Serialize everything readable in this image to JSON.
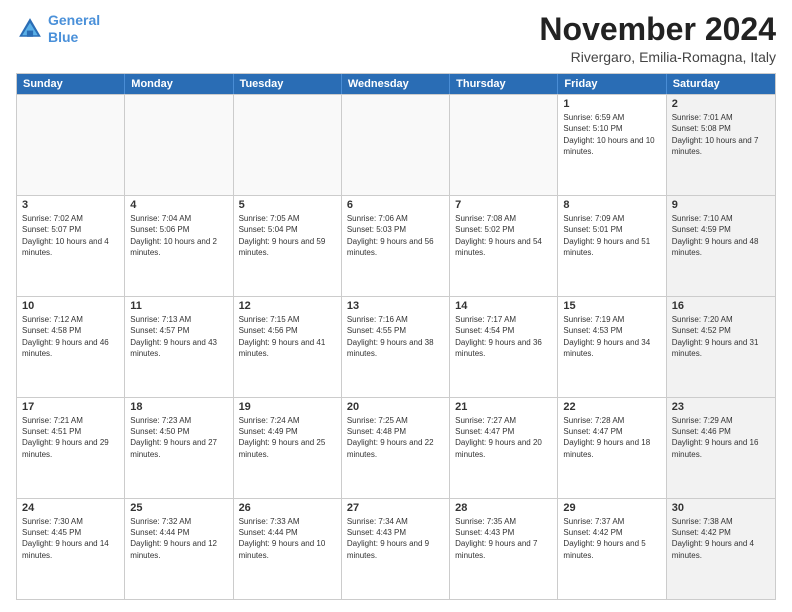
{
  "logo": {
    "line1": "General",
    "line2": "Blue"
  },
  "title": "November 2024",
  "location": "Rivergaro, Emilia-Romagna, Italy",
  "days_header": [
    "Sunday",
    "Monday",
    "Tuesday",
    "Wednesday",
    "Thursday",
    "Friday",
    "Saturday"
  ],
  "weeks": [
    [
      {
        "day": "",
        "info": "",
        "shaded": false,
        "empty": true
      },
      {
        "day": "",
        "info": "",
        "shaded": false,
        "empty": true
      },
      {
        "day": "",
        "info": "",
        "shaded": false,
        "empty": true
      },
      {
        "day": "",
        "info": "",
        "shaded": false,
        "empty": true
      },
      {
        "day": "",
        "info": "",
        "shaded": false,
        "empty": true
      },
      {
        "day": "1",
        "info": "Sunrise: 6:59 AM\nSunset: 5:10 PM\nDaylight: 10 hours and 10 minutes.",
        "shaded": false,
        "empty": false
      },
      {
        "day": "2",
        "info": "Sunrise: 7:01 AM\nSunset: 5:08 PM\nDaylight: 10 hours and 7 minutes.",
        "shaded": true,
        "empty": false
      }
    ],
    [
      {
        "day": "3",
        "info": "Sunrise: 7:02 AM\nSunset: 5:07 PM\nDaylight: 10 hours and 4 minutes.",
        "shaded": false,
        "empty": false
      },
      {
        "day": "4",
        "info": "Sunrise: 7:04 AM\nSunset: 5:06 PM\nDaylight: 10 hours and 2 minutes.",
        "shaded": false,
        "empty": false
      },
      {
        "day": "5",
        "info": "Sunrise: 7:05 AM\nSunset: 5:04 PM\nDaylight: 9 hours and 59 minutes.",
        "shaded": false,
        "empty": false
      },
      {
        "day": "6",
        "info": "Sunrise: 7:06 AM\nSunset: 5:03 PM\nDaylight: 9 hours and 56 minutes.",
        "shaded": false,
        "empty": false
      },
      {
        "day": "7",
        "info": "Sunrise: 7:08 AM\nSunset: 5:02 PM\nDaylight: 9 hours and 54 minutes.",
        "shaded": false,
        "empty": false
      },
      {
        "day": "8",
        "info": "Sunrise: 7:09 AM\nSunset: 5:01 PM\nDaylight: 9 hours and 51 minutes.",
        "shaded": false,
        "empty": false
      },
      {
        "day": "9",
        "info": "Sunrise: 7:10 AM\nSunset: 4:59 PM\nDaylight: 9 hours and 48 minutes.",
        "shaded": true,
        "empty": false
      }
    ],
    [
      {
        "day": "10",
        "info": "Sunrise: 7:12 AM\nSunset: 4:58 PM\nDaylight: 9 hours and 46 minutes.",
        "shaded": false,
        "empty": false
      },
      {
        "day": "11",
        "info": "Sunrise: 7:13 AM\nSunset: 4:57 PM\nDaylight: 9 hours and 43 minutes.",
        "shaded": false,
        "empty": false
      },
      {
        "day": "12",
        "info": "Sunrise: 7:15 AM\nSunset: 4:56 PM\nDaylight: 9 hours and 41 minutes.",
        "shaded": false,
        "empty": false
      },
      {
        "day": "13",
        "info": "Sunrise: 7:16 AM\nSunset: 4:55 PM\nDaylight: 9 hours and 38 minutes.",
        "shaded": false,
        "empty": false
      },
      {
        "day": "14",
        "info": "Sunrise: 7:17 AM\nSunset: 4:54 PM\nDaylight: 9 hours and 36 minutes.",
        "shaded": false,
        "empty": false
      },
      {
        "day": "15",
        "info": "Sunrise: 7:19 AM\nSunset: 4:53 PM\nDaylight: 9 hours and 34 minutes.",
        "shaded": false,
        "empty": false
      },
      {
        "day": "16",
        "info": "Sunrise: 7:20 AM\nSunset: 4:52 PM\nDaylight: 9 hours and 31 minutes.",
        "shaded": true,
        "empty": false
      }
    ],
    [
      {
        "day": "17",
        "info": "Sunrise: 7:21 AM\nSunset: 4:51 PM\nDaylight: 9 hours and 29 minutes.",
        "shaded": false,
        "empty": false
      },
      {
        "day": "18",
        "info": "Sunrise: 7:23 AM\nSunset: 4:50 PM\nDaylight: 9 hours and 27 minutes.",
        "shaded": false,
        "empty": false
      },
      {
        "day": "19",
        "info": "Sunrise: 7:24 AM\nSunset: 4:49 PM\nDaylight: 9 hours and 25 minutes.",
        "shaded": false,
        "empty": false
      },
      {
        "day": "20",
        "info": "Sunrise: 7:25 AM\nSunset: 4:48 PM\nDaylight: 9 hours and 22 minutes.",
        "shaded": false,
        "empty": false
      },
      {
        "day": "21",
        "info": "Sunrise: 7:27 AM\nSunset: 4:47 PM\nDaylight: 9 hours and 20 minutes.",
        "shaded": false,
        "empty": false
      },
      {
        "day": "22",
        "info": "Sunrise: 7:28 AM\nSunset: 4:47 PM\nDaylight: 9 hours and 18 minutes.",
        "shaded": false,
        "empty": false
      },
      {
        "day": "23",
        "info": "Sunrise: 7:29 AM\nSunset: 4:46 PM\nDaylight: 9 hours and 16 minutes.",
        "shaded": true,
        "empty": false
      }
    ],
    [
      {
        "day": "24",
        "info": "Sunrise: 7:30 AM\nSunset: 4:45 PM\nDaylight: 9 hours and 14 minutes.",
        "shaded": false,
        "empty": false
      },
      {
        "day": "25",
        "info": "Sunrise: 7:32 AM\nSunset: 4:44 PM\nDaylight: 9 hours and 12 minutes.",
        "shaded": false,
        "empty": false
      },
      {
        "day": "26",
        "info": "Sunrise: 7:33 AM\nSunset: 4:44 PM\nDaylight: 9 hours and 10 minutes.",
        "shaded": false,
        "empty": false
      },
      {
        "day": "27",
        "info": "Sunrise: 7:34 AM\nSunset: 4:43 PM\nDaylight: 9 hours and 9 minutes.",
        "shaded": false,
        "empty": false
      },
      {
        "day": "28",
        "info": "Sunrise: 7:35 AM\nSunset: 4:43 PM\nDaylight: 9 hours and 7 minutes.",
        "shaded": false,
        "empty": false
      },
      {
        "day": "29",
        "info": "Sunrise: 7:37 AM\nSunset: 4:42 PM\nDaylight: 9 hours and 5 minutes.",
        "shaded": false,
        "empty": false
      },
      {
        "day": "30",
        "info": "Sunrise: 7:38 AM\nSunset: 4:42 PM\nDaylight: 9 hours and 4 minutes.",
        "shaded": true,
        "empty": false
      }
    ]
  ]
}
